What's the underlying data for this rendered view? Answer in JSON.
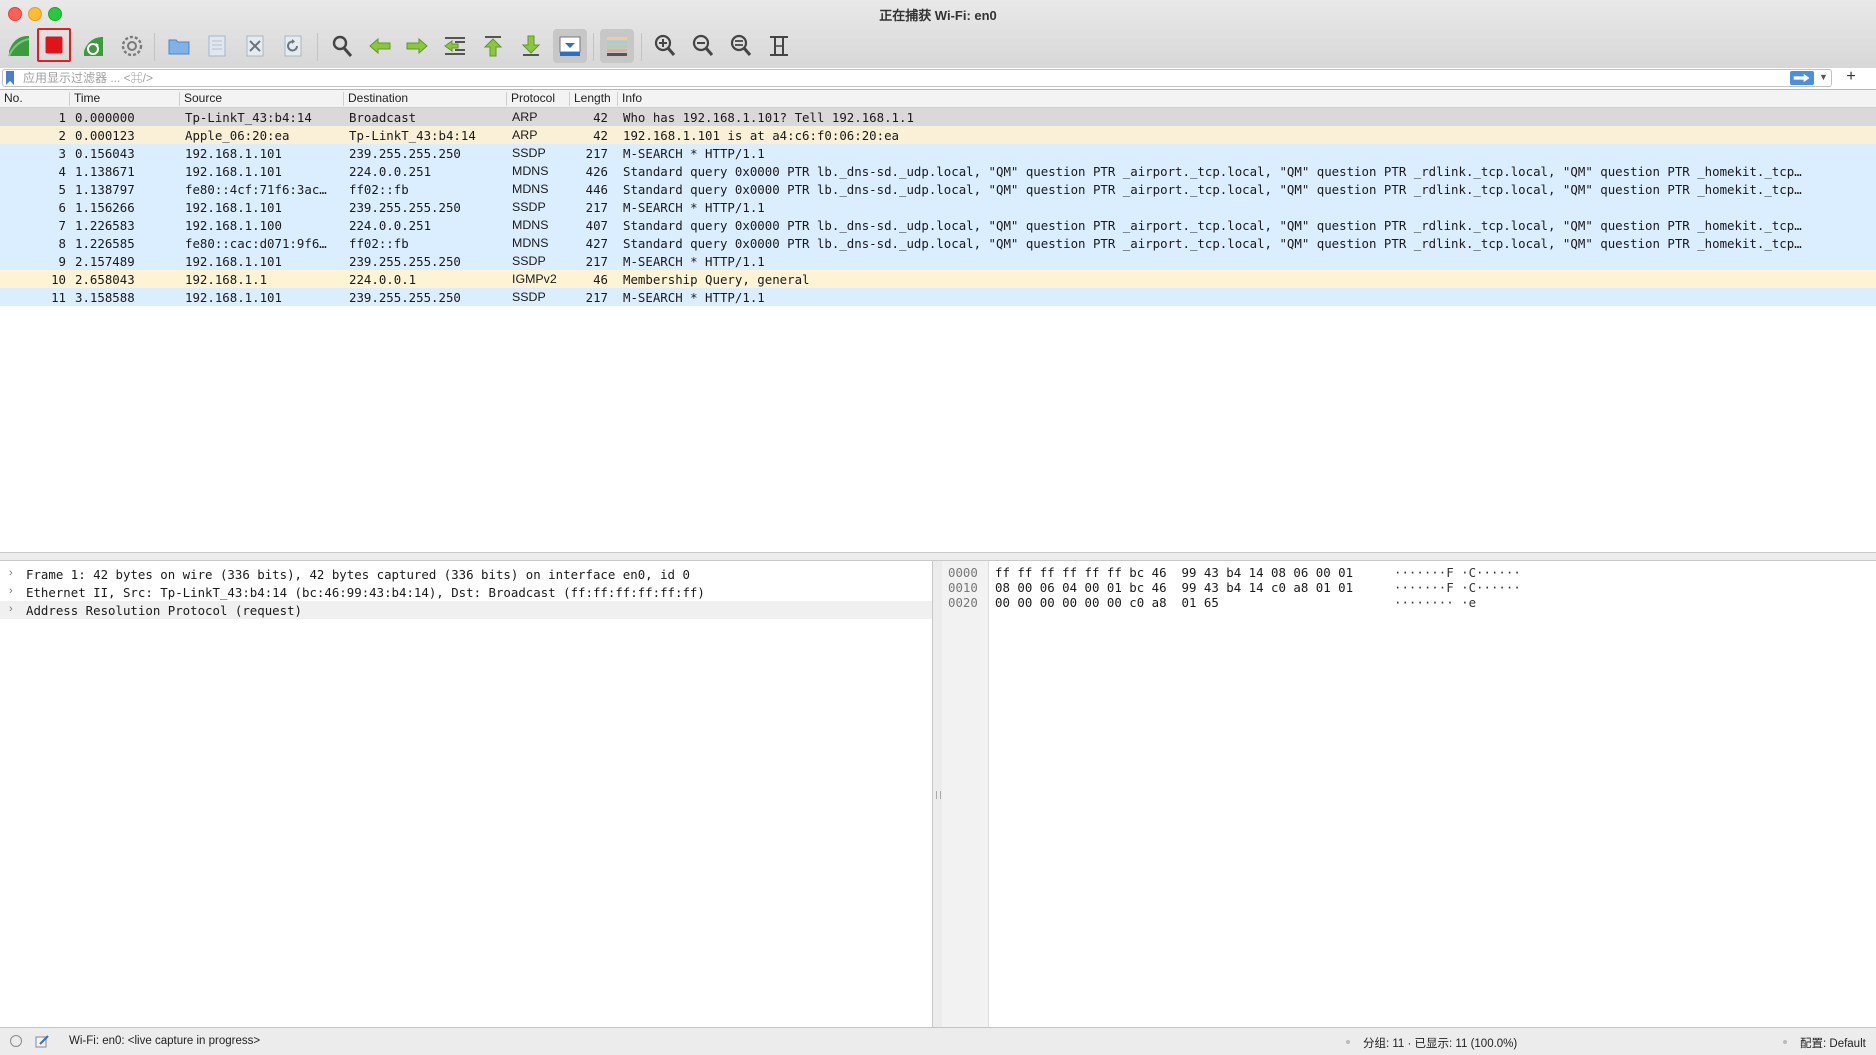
{
  "window": {
    "title": "正在捕获 Wi-Fi: en0"
  },
  "toolbar": {
    "buttons": [
      {
        "name": "start-capture-icon"
      },
      {
        "name": "stop-capture-icon"
      },
      {
        "name": "restart-capture-icon"
      },
      {
        "name": "capture-options-icon"
      },
      {
        "name": "open-file-icon"
      },
      {
        "name": "save-file-icon"
      },
      {
        "name": "close-file-icon"
      },
      {
        "name": "reload-file-icon"
      },
      {
        "name": "find-packet-icon"
      },
      {
        "name": "go-back-icon"
      },
      {
        "name": "go-forward-icon"
      },
      {
        "name": "go-to-packet-icon"
      },
      {
        "name": "go-first-icon"
      },
      {
        "name": "go-last-icon"
      },
      {
        "name": "auto-scroll-icon"
      },
      {
        "name": "colorize-icon"
      },
      {
        "name": "zoom-in-icon"
      },
      {
        "name": "zoom-out-icon"
      },
      {
        "name": "normal-size-icon"
      },
      {
        "name": "resize-columns-icon"
      }
    ]
  },
  "filter": {
    "placeholder": "应用显示过滤器 ... <⌘/>",
    "value": "",
    "add_label": "+"
  },
  "packet_list": {
    "columns": [
      "No.",
      "Time",
      "Source",
      "Destination",
      "Protocol",
      "Length",
      "Info"
    ],
    "colors": {
      "arp": "#faf0d7",
      "udp": "#daeeff",
      "igmp": "#fff3d6",
      "selected": "#d9d9d9"
    },
    "rows": [
      {
        "no": "1",
        "time": "0.000000",
        "source": "Tp-LinkT_43:b4:14",
        "destination": "Broadcast",
        "protocol": "ARP",
        "length": "42",
        "info": "Who has 192.168.1.101? Tell 192.168.1.1",
        "color": "selected"
      },
      {
        "no": "2",
        "time": "0.000123",
        "source": "Apple_06:20:ea",
        "destination": "Tp-LinkT_43:b4:14",
        "protocol": "ARP",
        "length": "42",
        "info": "192.168.1.101 is at a4:c6:f0:06:20:ea",
        "color": "arp"
      },
      {
        "no": "3",
        "time": "0.156043",
        "source": "192.168.1.101",
        "destination": "239.255.255.250",
        "protocol": "SSDP",
        "length": "217",
        "info": "M-SEARCH * HTTP/1.1",
        "color": "udp"
      },
      {
        "no": "4",
        "time": "1.138671",
        "source": "192.168.1.101",
        "destination": "224.0.0.251",
        "protocol": "MDNS",
        "length": "426",
        "info": "Standard query 0x0000 PTR lb._dns-sd._udp.local, \"QM\" question PTR _airport._tcp.local, \"QM\" question PTR _rdlink._tcp.local, \"QM\" question PTR _homekit._tcp…",
        "color": "udp"
      },
      {
        "no": "5",
        "time": "1.138797",
        "source": "fe80::4cf:71f6:3ac…",
        "destination": "ff02::fb",
        "protocol": "MDNS",
        "length": "446",
        "info": "Standard query 0x0000 PTR lb._dns-sd._udp.local, \"QM\" question PTR _airport._tcp.local, \"QM\" question PTR _rdlink._tcp.local, \"QM\" question PTR _homekit._tcp…",
        "color": "udp"
      },
      {
        "no": "6",
        "time": "1.156266",
        "source": "192.168.1.101",
        "destination": "239.255.255.250",
        "protocol": "SSDP",
        "length": "217",
        "info": "M-SEARCH * HTTP/1.1",
        "color": "udp"
      },
      {
        "no": "7",
        "time": "1.226583",
        "source": "192.168.1.100",
        "destination": "224.0.0.251",
        "protocol": "MDNS",
        "length": "407",
        "info": "Standard query 0x0000 PTR lb._dns-sd._udp.local, \"QM\" question PTR _airport._tcp.local, \"QM\" question PTR _rdlink._tcp.local, \"QM\" question PTR _homekit._tcp…",
        "color": "udp"
      },
      {
        "no": "8",
        "time": "1.226585",
        "source": "fe80::cac:d071:9f6…",
        "destination": "ff02::fb",
        "protocol": "MDNS",
        "length": "427",
        "info": "Standard query 0x0000 PTR lb._dns-sd._udp.local, \"QM\" question PTR _airport._tcp.local, \"QM\" question PTR _rdlink._tcp.local, \"QM\" question PTR _homekit._tcp…",
        "color": "udp"
      },
      {
        "no": "9",
        "time": "2.157489",
        "source": "192.168.1.101",
        "destination": "239.255.255.250",
        "protocol": "SSDP",
        "length": "217",
        "info": "M-SEARCH * HTTP/1.1",
        "color": "udp"
      },
      {
        "no": "10",
        "time": "2.658043",
        "source": "192.168.1.1",
        "destination": "224.0.0.1",
        "protocol": "IGMPv2",
        "length": "46",
        "info": "Membership Query, general",
        "color": "igmp"
      },
      {
        "no": "11",
        "time": "3.158588",
        "source": "192.168.1.101",
        "destination": "239.255.255.250",
        "protocol": "SSDP",
        "length": "217",
        "info": "M-SEARCH * HTTP/1.1",
        "color": "udp"
      }
    ]
  },
  "details": {
    "items": [
      {
        "arrow": "›",
        "text": "Frame 1: 42 bytes on wire (336 bits), 42 bytes captured (336 bits) on interface en0, id 0"
      },
      {
        "arrow": "›",
        "text": "Ethernet II, Src: Tp-LinkT_43:b4:14 (bc:46:99:43:b4:14), Dst: Broadcast (ff:ff:ff:ff:ff:ff)"
      },
      {
        "arrow": "›",
        "text": "Address Resolution Protocol (request)"
      }
    ]
  },
  "bytes": {
    "rows": [
      {
        "offset": "0000",
        "hex": "ff ff ff ff ff ff bc 46  99 43 b4 14 08 06 00 01",
        "ascii": "·······F ·C······"
      },
      {
        "offset": "0010",
        "hex": "08 00 06 04 00 01 bc 46  99 43 b4 14 c0 a8 01 01",
        "ascii": "·······F ·C······"
      },
      {
        "offset": "0020",
        "hex": "00 00 00 00 00 00 c0 a8  01 65",
        "ascii": "········ ·e"
      }
    ]
  },
  "status": {
    "capture_text": "Wi-Fi: en0: <live capture in progress>",
    "packets_text": "分组: 11 · 已显示: 11 (100.0%)",
    "profile_text": "配置: Default"
  }
}
